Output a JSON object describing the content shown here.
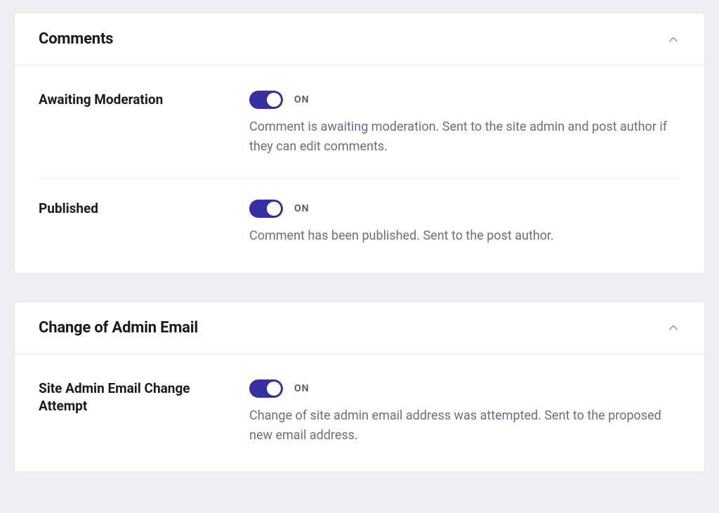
{
  "toggle_state_on": "ON",
  "panels": [
    {
      "id": "comments",
      "title": "Comments",
      "settings": [
        {
          "id": "awaiting-moderation",
          "label": "Awaiting Moderation",
          "on": true,
          "description": "Comment is awaiting moderation. Sent to the site admin and post author if they can edit comments."
        },
        {
          "id": "published",
          "label": "Published",
          "on": true,
          "description": "Comment has been published. Sent to the post author."
        }
      ]
    },
    {
      "id": "change-admin-email",
      "title": "Change of Admin Email",
      "settings": [
        {
          "id": "site-admin-email-change-attempt",
          "label": "Site Admin Email Change Attempt",
          "on": true,
          "description": "Change of site admin email address was attempted. Sent to the proposed new email address."
        }
      ]
    }
  ]
}
